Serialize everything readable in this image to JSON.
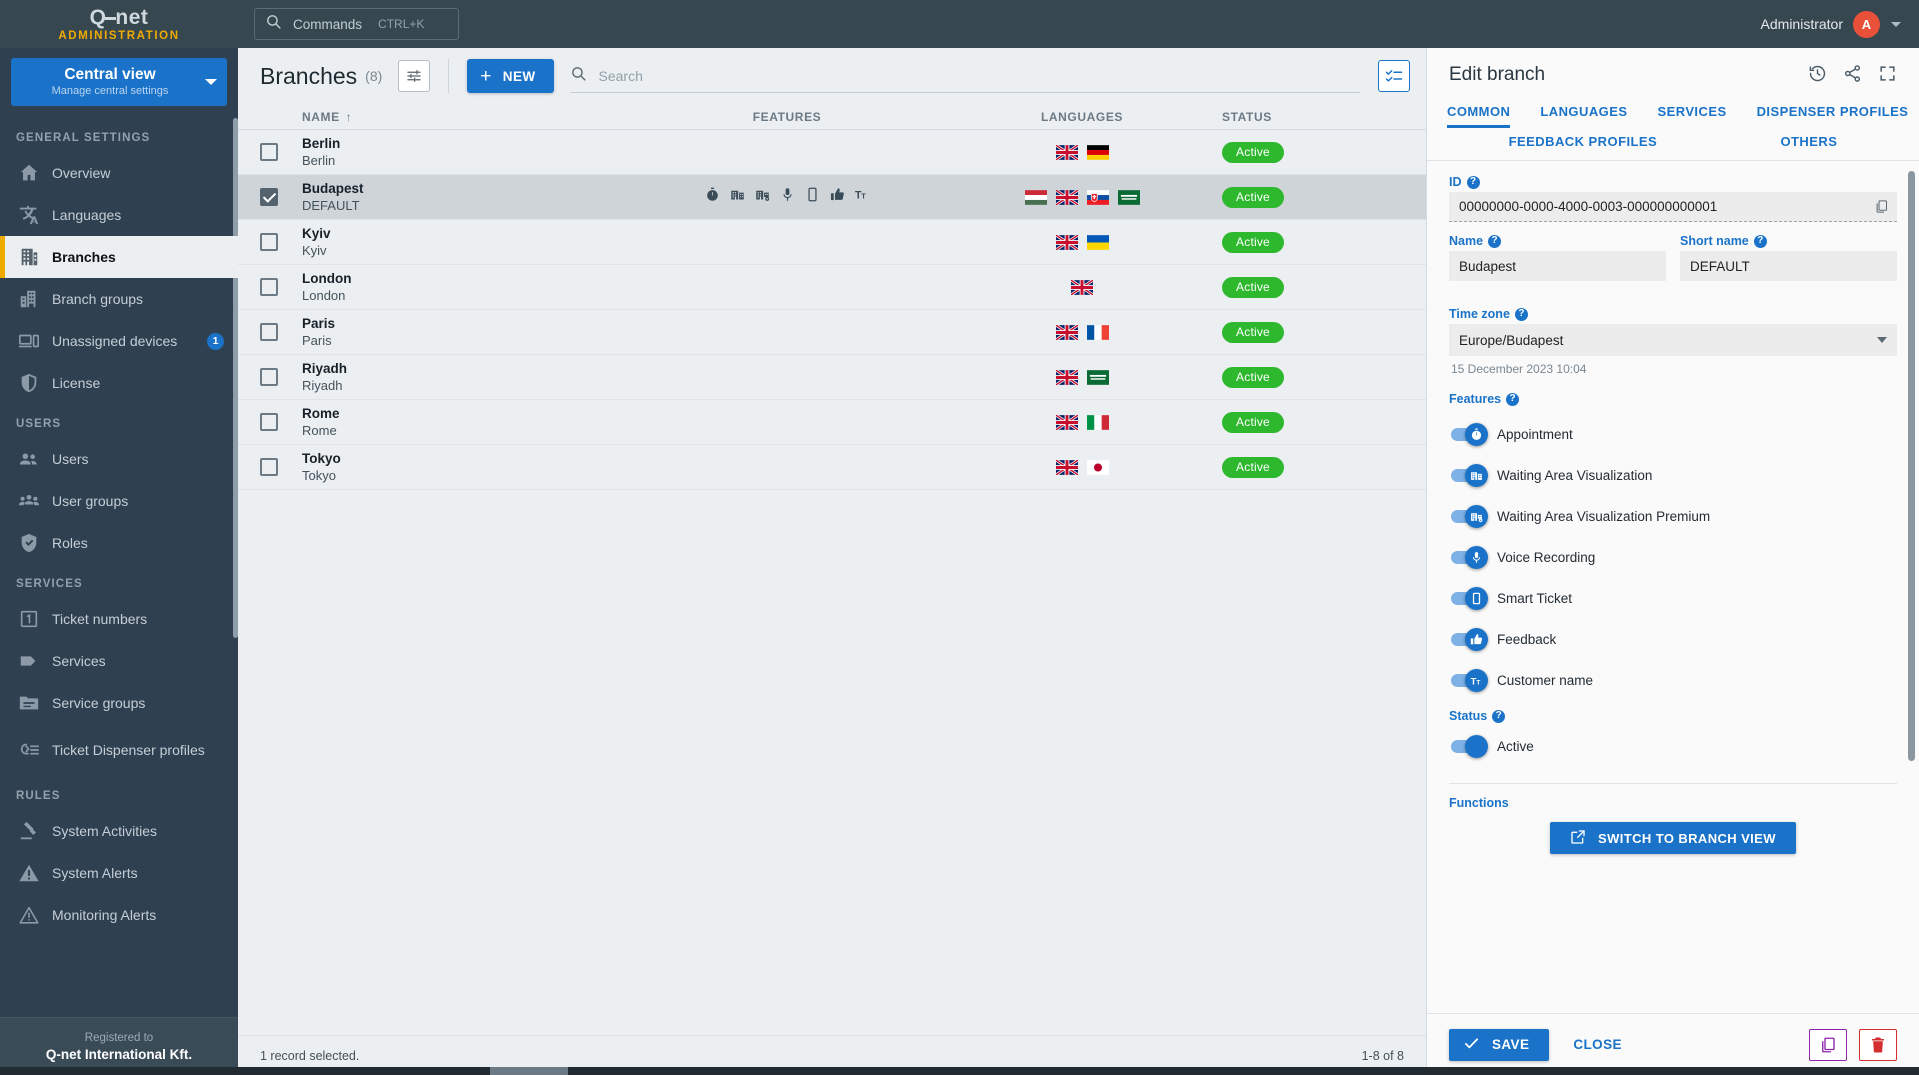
{
  "brand": {
    "logo": "Q net",
    "logo_pre": "Q",
    "logo_post": "net",
    "subtitle": "ADMINISTRATION"
  },
  "view_switch": {
    "title": "Central view",
    "subtitle": "Manage central settings",
    "icon": "chevron-down-icon"
  },
  "topbar": {
    "commands_label": "Commands",
    "commands_shortcut": "CTRL+K",
    "search_icon": "search-icon",
    "user_name": "Administrator",
    "avatar_initial": "A"
  },
  "sidebar": {
    "sections": [
      {
        "title": "GENERAL SETTINGS",
        "items": [
          {
            "label": "Overview",
            "icon": "home-icon",
            "active": false
          },
          {
            "label": "Languages",
            "icon": "translate-icon",
            "active": false
          },
          {
            "label": "Branches",
            "icon": "building-icon",
            "active": true
          },
          {
            "label": "Branch groups",
            "icon": "buildings-icon",
            "active": false
          },
          {
            "label": "Unassigned devices",
            "icon": "devices-icon",
            "active": false,
            "badge": "1"
          },
          {
            "label": "License",
            "icon": "shield-icon",
            "active": false
          }
        ]
      },
      {
        "title": "USERS",
        "items": [
          {
            "label": "Users",
            "icon": "users-icon",
            "active": false
          },
          {
            "label": "User groups",
            "icon": "user-group-icon",
            "active": false
          },
          {
            "label": "Roles",
            "icon": "shield-check-icon",
            "active": false
          }
        ]
      },
      {
        "title": "SERVICES",
        "items": [
          {
            "label": "Ticket numbers",
            "icon": "ticket-number-icon",
            "active": false
          },
          {
            "label": "Services",
            "icon": "tag-icon",
            "active": false
          },
          {
            "label": "Service groups",
            "icon": "folder-icon",
            "active": false
          },
          {
            "label": "Ticket Dispenser profiles",
            "icon": "dispenser-icon",
            "active": false,
            "two_line": true
          }
        ]
      },
      {
        "title": "RULES",
        "items": [
          {
            "label": "System Activities",
            "icon": "activities-icon",
            "active": false
          },
          {
            "label": "System Alerts",
            "icon": "alert-filled-icon",
            "active": false
          },
          {
            "label": "Monitoring Alerts",
            "icon": "alert-outline-icon",
            "active": false
          }
        ]
      }
    ],
    "footer": {
      "registered_label": "Registered to",
      "company": "Q-net International Kft."
    }
  },
  "list": {
    "title": "Branches",
    "count": "(8)",
    "filter_icon": "filter-settings-icon",
    "new_button": "NEW",
    "search_placeholder": "Search",
    "search_value": "",
    "select_all_icon": "select-all-icon",
    "columns": [
      "NAME",
      "FEATURES",
      "LANGUAGES",
      "STATUS"
    ],
    "sort_column": "NAME",
    "sort_direction": "ascending",
    "rows": [
      {
        "name": "Berlin",
        "sub": "Berlin",
        "selected": false,
        "features": [],
        "flags": [
          "gb",
          "de"
        ],
        "status": "Active"
      },
      {
        "name": "Budapest",
        "sub": "DEFAULT",
        "selected": true,
        "features": [
          "appointment",
          "waiting-area",
          "waiting-area-premium",
          "voice-recording",
          "smart-ticket",
          "feedback",
          "customer-name"
        ],
        "flags": [
          "hu",
          "gb",
          "sk",
          "sa"
        ],
        "status": "Active"
      },
      {
        "name": "Kyiv",
        "sub": "Kyiv",
        "selected": false,
        "features": [],
        "flags": [
          "gb",
          "ua"
        ],
        "status": "Active"
      },
      {
        "name": "London",
        "sub": "London",
        "selected": false,
        "features": [],
        "flags": [
          "gb"
        ],
        "status": "Active"
      },
      {
        "name": "Paris",
        "sub": "Paris",
        "selected": false,
        "features": [],
        "flags": [
          "gb",
          "fr"
        ],
        "status": "Active"
      },
      {
        "name": "Riyadh",
        "sub": "Riyadh",
        "selected": false,
        "features": [],
        "flags": [
          "gb",
          "sa"
        ],
        "status": "Active"
      },
      {
        "name": "Rome",
        "sub": "Rome",
        "selected": false,
        "features": [],
        "flags": [
          "gb",
          "it"
        ],
        "status": "Active"
      },
      {
        "name": "Tokyo",
        "sub": "Tokyo",
        "selected": false,
        "features": [],
        "flags": [
          "gb",
          "jp"
        ],
        "status": "Active"
      }
    ],
    "footer_left": "1 record selected.",
    "footer_right": "1-8 of 8"
  },
  "panel": {
    "title": "Edit branch",
    "head_icons": [
      "history-icon",
      "share-icon",
      "fullscreen-icon"
    ],
    "tabs_row1": [
      {
        "label": "COMMON",
        "active": true
      },
      {
        "label": "LANGUAGES",
        "active": false
      },
      {
        "label": "SERVICES",
        "active": false
      },
      {
        "label": "DISPENSER PROFILES",
        "active": false
      }
    ],
    "tabs_row2": [
      {
        "label": "FEEDBACK PROFILES",
        "active": false
      },
      {
        "label": "OTHERS",
        "active": false
      }
    ],
    "id": {
      "label": "ID",
      "value": "00000000-0000-4000-0003-000000000001",
      "copy_icon": "copy-icon"
    },
    "name": {
      "label": "Name",
      "value": "Budapest"
    },
    "short_name": {
      "label": "Short name",
      "value": "DEFAULT"
    },
    "time_zone": {
      "label": "Time zone",
      "value": "Europe/Budapest",
      "note": "15 December 2023 10:04"
    },
    "features_label": "Features",
    "features": [
      {
        "label": "Appointment",
        "icon": "stopwatch-icon",
        "on": true
      },
      {
        "label": "Waiting Area Visualization",
        "icon": "waiting-area-icon",
        "on": true
      },
      {
        "label": "Waiting Area Visualization Premium",
        "icon": "waiting-area-premium-icon",
        "on": true
      },
      {
        "label": "Voice Recording",
        "icon": "microphone-icon",
        "on": true
      },
      {
        "label": "Smart Ticket",
        "icon": "smartphone-icon",
        "on": true
      },
      {
        "label": "Feedback",
        "icon": "thumbs-up-icon",
        "on": true
      },
      {
        "label": "Customer name",
        "icon": "text-format-icon",
        "on": true
      }
    ],
    "status": {
      "label": "Status",
      "value": "Active",
      "on": true
    },
    "functions_label": "Functions",
    "switch_branch_button": {
      "label": "SWITCH TO BRANCH VIEW",
      "icon": "external-link-icon"
    },
    "save_button": {
      "label": "SAVE",
      "icon": "check-icon"
    },
    "close_button": "CLOSE",
    "copy_button_icon": "copy-icon",
    "delete_button_icon": "trash-icon"
  },
  "colors": {
    "sidebar_bg": "#2f4050",
    "topbar_bg": "#37474f",
    "accent_blue": "#1a73c8",
    "accent_orange": "#f0ab00",
    "status_green": "#2eb82e",
    "avatar_red": "#e8503a",
    "delete_red": "#d32f2f",
    "copy_purple": "#8e24aa"
  }
}
